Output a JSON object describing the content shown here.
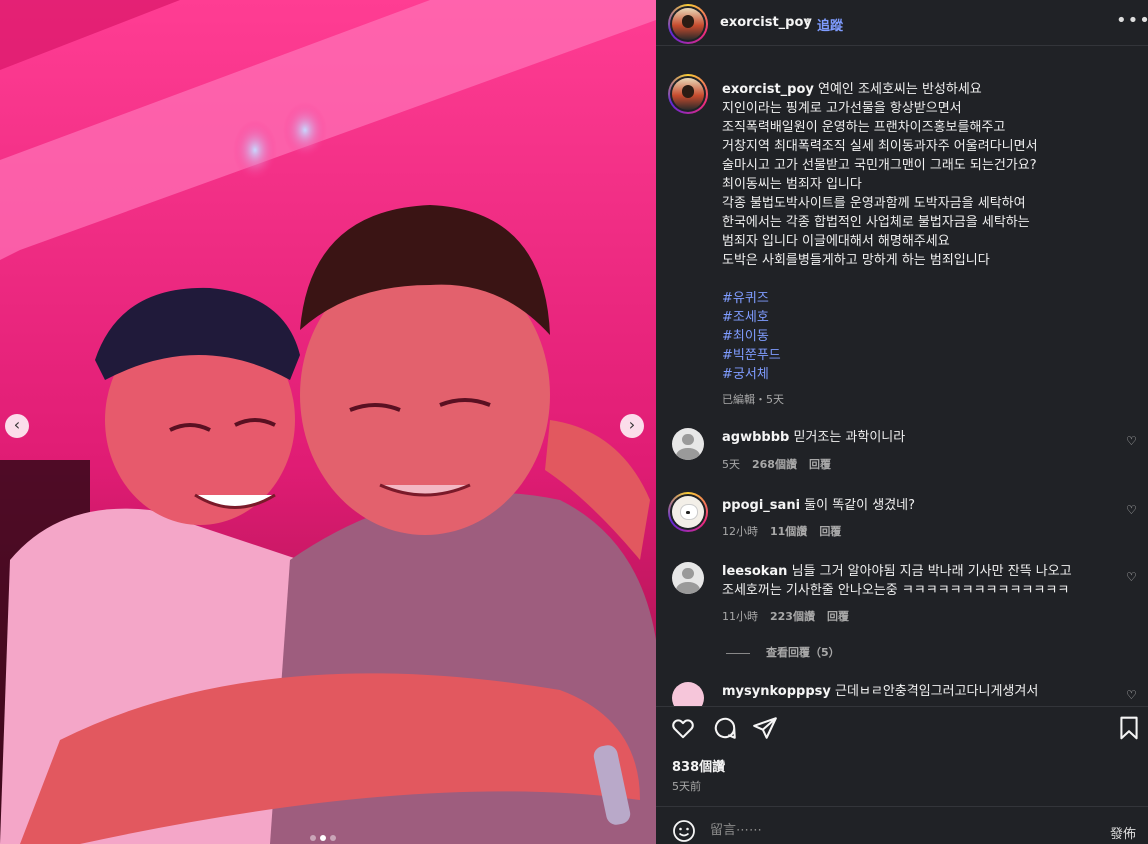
{
  "media": {
    "prev_glyph": "‹",
    "next_glyph": "›",
    "slide_count": 3,
    "active_slide": 2
  },
  "header": {
    "username": "exorcist_poy",
    "separator": "•",
    "follow_label": "追蹤",
    "more_glyph": "•••"
  },
  "caption": {
    "username": "exorcist_poy",
    "lines": [
      "연예인 조세호씨는 반성하세요",
      "지인이라는 핑계로 고가선물을 항상받으면서",
      "조직폭력배일원이 운영하는 프랜차이즈홍보를해주고",
      "거창지역 최대폭력조직 실세 최이동과자주 어울려다니면서",
      "술마시고 고가 선물받고 국민개그맨이 그래도 되는건가요?",
      "최이동씨는 범죄자 입니다",
      "각종 불법도박사이트를 운영과함께 도박자금을 세탁하여",
      "한국에서는 각종 합법적인 사업체로 불법자금을 세탁하는",
      "범죄자 입니다 이글에대해서 해명해주세요",
      "도박은 사회를병들게하고 망하게 하는 범죄입니다"
    ],
    "hashtags": [
      "#유퀴즈",
      "#조세호",
      "#최이동",
      "#빅쭌푸드",
      "#궁서체"
    ],
    "meta": "已編輯・5天"
  },
  "comments": [
    {
      "username": "agwbbbb",
      "text": "믿거조는 과학이니라",
      "age": "5天",
      "likes": "268個讚",
      "reply": "回覆"
    },
    {
      "username": "ppogi_sani",
      "text": "둘이 똑같이 생겼네?",
      "age": "12小時",
      "likes": "11個讚",
      "reply": "回覆"
    },
    {
      "username": "leesokan",
      "text": "님들 그거 알아야됨 지금 박나래 기사만 잔뜩 나오고",
      "text2": "조세호꺼는 기사한줄 안나오는중 ㅋㅋㅋㅋㅋㅋㅋㅋㅋㅋㅋㅋㅋㅋ",
      "age": "11小時",
      "likes": "223個讚",
      "reply": "回覆"
    },
    {
      "username": "mysynkopppsy",
      "text": "근데ㅂㄹ안충격임그러고다니게생겨서"
    }
  ],
  "view_replies": "查看回覆（5）",
  "actions": {
    "likes": "838個讚",
    "date": "5天前"
  },
  "compose": {
    "placeholder": "留言⋯⋯",
    "post_label": "發佈"
  },
  "colors": {
    "panel_bg": "#202226",
    "link": "#7f9cff",
    "photo_tint": "#e81b78"
  }
}
